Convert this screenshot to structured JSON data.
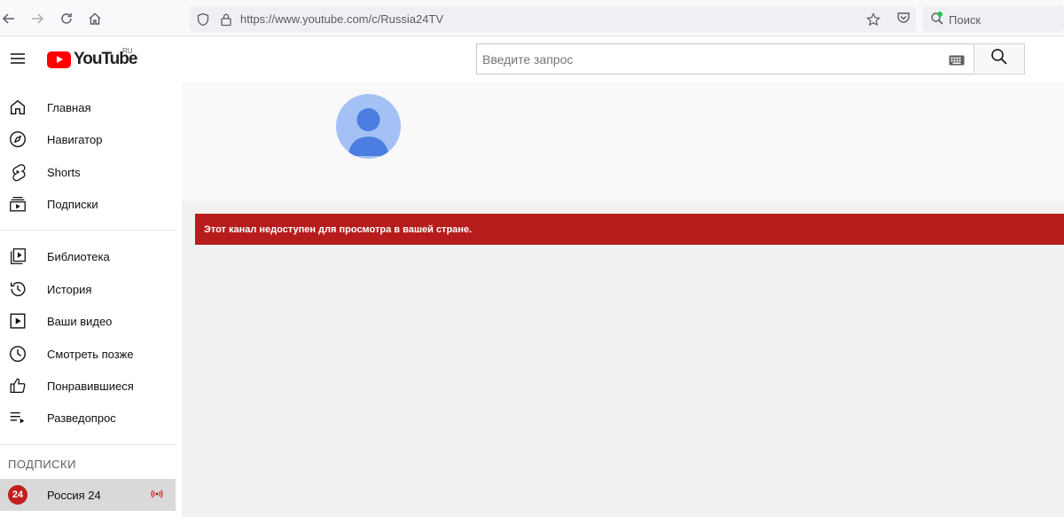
{
  "browser": {
    "url": "https://www.youtube.com/c/Russia24TV",
    "search_placeholder": "Поиск"
  },
  "header": {
    "logo_text": "YouTube",
    "country_code": "RU",
    "search_placeholder": "Введите запрос"
  },
  "sidebar": {
    "main_items": [
      {
        "label": "Главная",
        "icon": "home-icon"
      },
      {
        "label": "Навигатор",
        "icon": "compass-icon"
      },
      {
        "label": "Shorts",
        "icon": "shorts-icon"
      },
      {
        "label": "Подписки",
        "icon": "subscriptions-icon"
      }
    ],
    "library_items": [
      {
        "label": "Библиотека",
        "icon": "library-icon"
      },
      {
        "label": "История",
        "icon": "history-icon"
      },
      {
        "label": "Ваши видео",
        "icon": "your-videos-icon"
      },
      {
        "label": "Смотреть позже",
        "icon": "watch-later-icon"
      },
      {
        "label": "Понравившиеся",
        "icon": "liked-icon"
      },
      {
        "label": "Разведопрос",
        "icon": "playlist-icon"
      }
    ],
    "subscriptions_title": "ПОДПИСКИ",
    "subscriptions": [
      {
        "label": "Россия 24",
        "avatar_text": "24"
      }
    ]
  },
  "main": {
    "alert_message": "Этот канал недоступен для просмотра в вашей стране."
  },
  "colors": {
    "alert_bg": "#b71c1c",
    "logo_red": "#ff0000",
    "avatar_bg": "#a4c1f5"
  }
}
